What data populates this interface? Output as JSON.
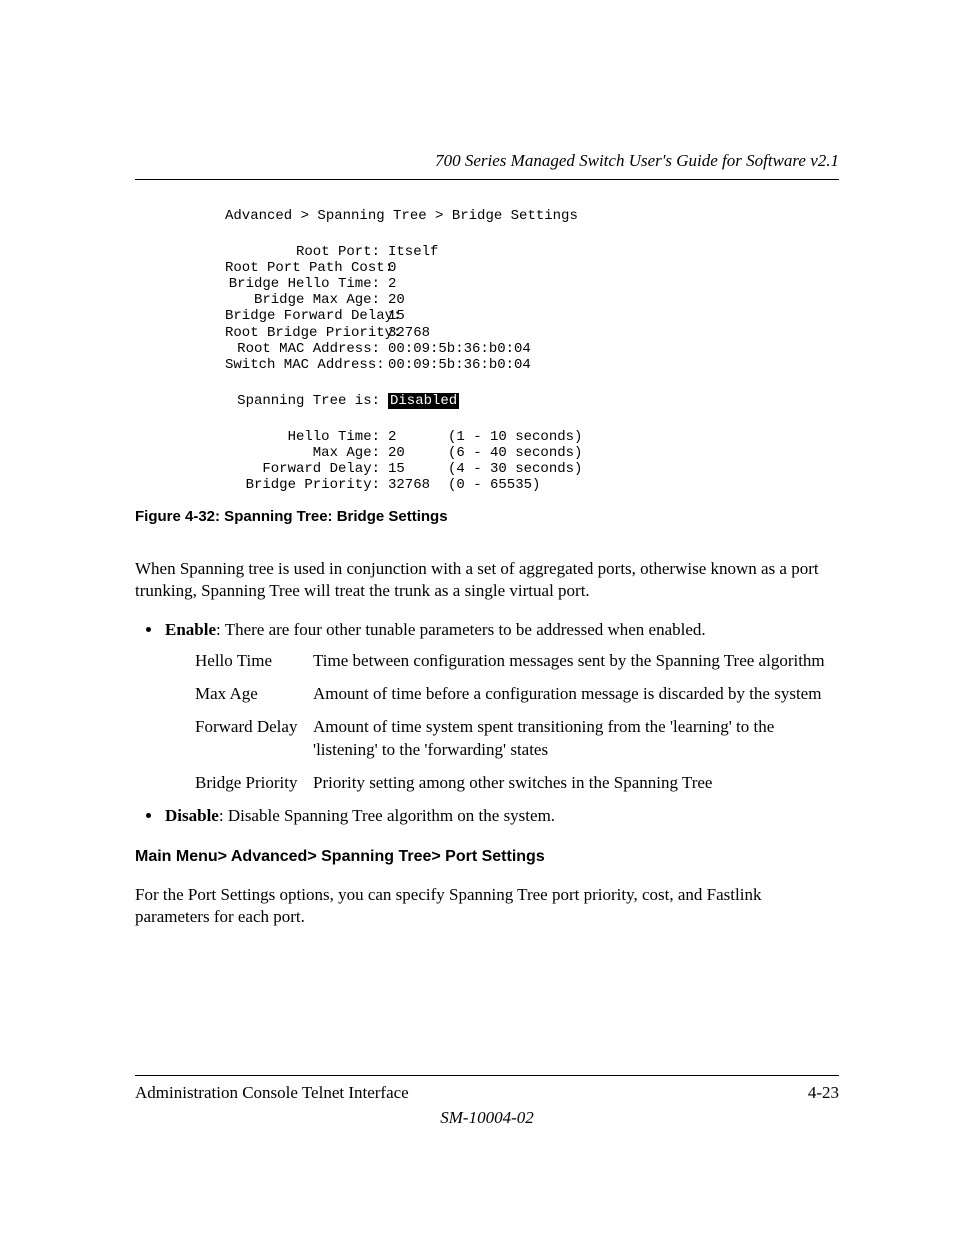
{
  "header": {
    "running_title": "700 Series Managed Switch User's Guide for Software v2.1"
  },
  "screenshot": {
    "breadcrumb": "Advanced > Spanning Tree > Bridge Settings",
    "info_rows": [
      {
        "label": "Root Port:",
        "value": "Itself"
      },
      {
        "label": "Root Port Path Cost:",
        "value": "0"
      },
      {
        "label": "Bridge Hello Time:",
        "value": "2"
      },
      {
        "label": "Bridge Max Age:",
        "value": "20"
      },
      {
        "label": "Bridge Forward Delay:",
        "value": "15"
      },
      {
        "label": "Root Bridge Priority:",
        "value": "32768"
      },
      {
        "label": "Root MAC Address:",
        "value": "00:09:5b:36:b0:04"
      },
      {
        "label": "Switch MAC Address:",
        "value": "00:09:5b:36:b0:04"
      }
    ],
    "status_row": {
      "label": "Spanning Tree is:",
      "value": "Disabled"
    },
    "tunable_rows": [
      {
        "label": "Hello Time:",
        "value": "2",
        "range": "(1 - 10 seconds)"
      },
      {
        "label": "Max Age:",
        "value": "20",
        "range": "(6 - 40 seconds)"
      },
      {
        "label": "Forward Delay:",
        "value": "15",
        "range": "(4 - 30 seconds)"
      },
      {
        "label": "Bridge Priority:",
        "value": "32768",
        "range": "(0 - 65535)"
      }
    ]
  },
  "figure_caption": "Figure 4-32:  Spanning Tree: Bridge Settings",
  "body": {
    "para1": "When Spanning tree is used in conjunction with a set of aggregated ports, otherwise known as a port trunking, Spanning Tree will treat the trunk as a single virtual port.",
    "enable_label": "Enable",
    "enable_text": ": There are four other tunable parameters to be addressed when enabled.",
    "params": [
      {
        "name": "Hello Time",
        "desc": "Time between configuration messages sent by the Spanning Tree algorithm"
      },
      {
        "name": "Max Age",
        "desc": "Amount of time before a configuration message is discarded by the system"
      },
      {
        "name": "Forward Delay",
        "desc": "Amount of time system spent transitioning from the 'learning' to the 'listening' to the 'forwarding' states"
      },
      {
        "name": "Bridge Priority",
        "desc": "Priority setting among other switches in the Spanning Tree"
      }
    ],
    "disable_label": "Disable",
    "disable_text": ":  Disable Spanning Tree algorithm on the system.",
    "subhead": "Main Menu> Advanced> Spanning Tree> Port Settings",
    "para2": "For the Port Settings options, you can specify Spanning Tree port priority, cost, and Fastlink parameters for each port."
  },
  "footer": {
    "left": "Administration Console Telnet Interface",
    "right": "4-23",
    "center": "SM-10004-02"
  }
}
